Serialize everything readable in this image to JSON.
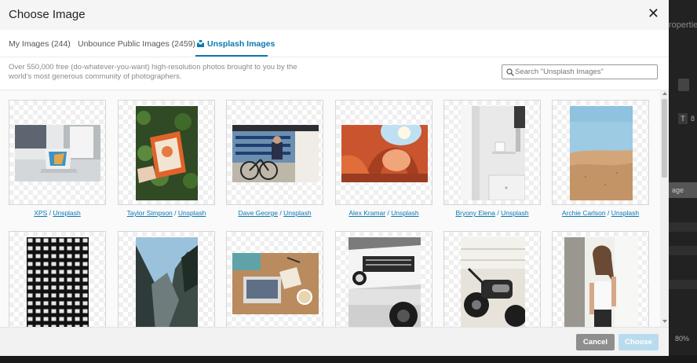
{
  "modal": {
    "title": "Choose Image",
    "close_glyph": "✕"
  },
  "tabs": [
    {
      "label": "My Images (244)",
      "active": false
    },
    {
      "label": "Unbounce Public Images (2459)",
      "active": false
    },
    {
      "label": "Unsplash Images",
      "active": true
    }
  ],
  "description": "Over 550,000 free (do-whatever-you-want) high-resolution photos brought to you by the world's most generous community of photographers.",
  "search": {
    "placeholder": "Search \"Unsplash Images\"",
    "value": ""
  },
  "images": [
    {
      "author": "XPS",
      "source": "Unsplash",
      "subject": "laptop on white desk"
    },
    {
      "author": "Taylor Simpson",
      "source": "Unsplash",
      "subject": "orange book in front of leaves"
    },
    {
      "author": "Dave George",
      "source": "Unsplash",
      "subject": "bicycle by a window"
    },
    {
      "author": "Alex Kramar",
      "source": "Unsplash",
      "subject": "red rock arch"
    },
    {
      "author": "Bryony Elena",
      "source": "Unsplash",
      "subject": "white room with shelves"
    },
    {
      "author": "Archie Carlson",
      "source": "Unsplash",
      "subject": "sand dune and sky"
    },
    {
      "author": "",
      "source": "",
      "subject": "black and white building facade"
    },
    {
      "author": "",
      "source": "",
      "subject": "mountain valley"
    },
    {
      "author": "",
      "source": "",
      "subject": "laptop on wooden table"
    },
    {
      "author": "",
      "source": "",
      "subject": "white off-road vehicle"
    },
    {
      "author": "",
      "source": "",
      "subject": "motorcycle by a brick wall"
    },
    {
      "author": "",
      "source": "",
      "subject": "woman by a window"
    }
  ],
  "footer": {
    "cancel_label": "Cancel",
    "choose_label": "Choose"
  },
  "background": {
    "properties_label": "roperties",
    "zoom_label": "80%",
    "t_label": "T",
    "s_label": "8",
    "image_label": "age"
  },
  "colors": {
    "accent": "#0b79b0",
    "cancel_button": "#8e8e8e",
    "choose_button_disabled": "#b9dbee"
  },
  "icons": {
    "close": "close-icon",
    "unsplash_tab": "unsplash-logo-icon",
    "search": "search-icon"
  }
}
